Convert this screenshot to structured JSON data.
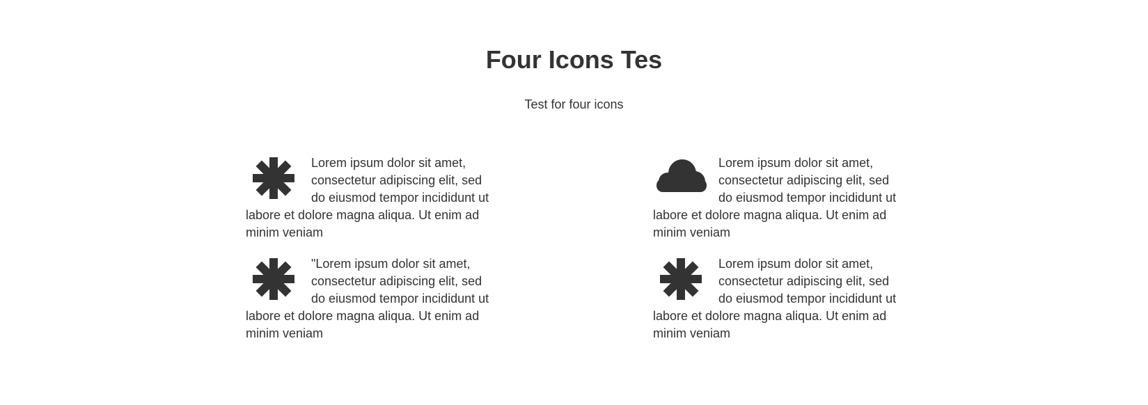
{
  "header": {
    "title": "Four Icons Tes",
    "subtitle": "Test for four icons"
  },
  "features": [
    {
      "icon": "asterisk-icon",
      "text": "Lorem ipsum dolor sit amet, consectetur adipiscing elit, sed do eiusmod tempor incididunt ut labore et dolore magna aliqua. Ut enim ad minim veniam"
    },
    {
      "icon": "cloud-icon",
      "text": "Lorem ipsum dolor sit amet, consectetur adipiscing elit, sed do eiusmod tempor incididunt ut labore et dolore magna aliqua. Ut enim ad minim veniam"
    },
    {
      "icon": "asterisk-icon",
      "text": "\"Lorem ipsum dolor sit amet, consectetur adipiscing elit, sed do eiusmod tempor incididunt ut labore et dolore magna aliqua. Ut enim ad minim veniam"
    },
    {
      "icon": "asterisk-icon",
      "text": "Lorem ipsum dolor sit amet, consectetur adipiscing elit, sed do eiusmod tempor incididunt ut labore et dolore magna aliqua. Ut enim ad minim veniam"
    }
  ],
  "colors": {
    "text": "#333333",
    "background": "#ffffff"
  }
}
